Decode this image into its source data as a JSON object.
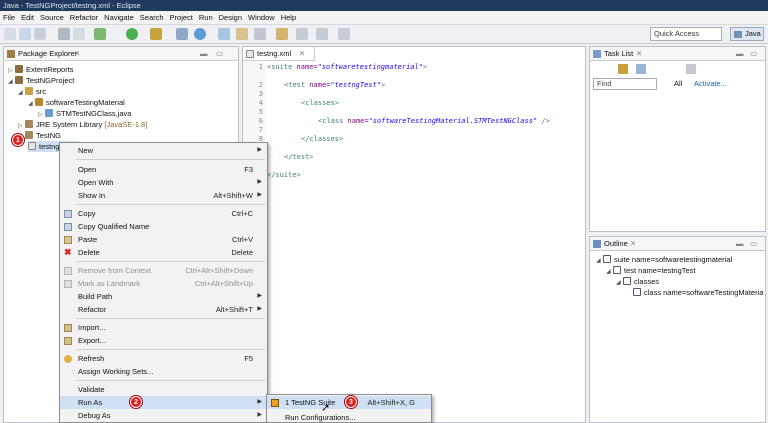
{
  "window": {
    "title": "Java - TestNGProject/testng.xml - Eclipse"
  },
  "menubar": [
    "File",
    "Edit",
    "Source",
    "Refactor",
    "Navigate",
    "Search",
    "Project",
    "Run",
    "Design",
    "Window",
    "Help"
  ],
  "toolbar": {
    "quick_access": "Quick Access",
    "perspective": "Java"
  },
  "package_explorer": {
    "tab": "Package Explorer",
    "items": [
      "ExtentReports",
      "TestNGProject",
      "src",
      "softwareTestingMaterial",
      "STMTestNGClass.java",
      "JRE System Library",
      "[JavaSE-1.8]",
      "TestNG",
      "testng.xml"
    ]
  },
  "editor": {
    "tab": "testng.xml",
    "line_numbers": [
      "1",
      "2",
      "3",
      "4",
      "5",
      "6",
      "7",
      "8",
      "9",
      "10",
      "11"
    ],
    "lines": [
      {
        "pre": "<suite ",
        "attr": "name=",
        "val": "\"softwaretestingmaterial\"",
        "post": ">"
      },
      {
        "pre": "<test ",
        "attr": "name=",
        "val": "\"testngTest\"",
        "post": ">"
      },
      {
        "pre": "<classes>",
        "attr": "",
        "val": "",
        "post": ""
      },
      {
        "pre": "<class ",
        "attr": "name=",
        "val": "\"softwareTestingMaterial.STMTestNGClass\"",
        "post": " />"
      },
      {
        "pre": "</classes>",
        "attr": "",
        "val": "",
        "post": ""
      },
      {
        "pre": "</test>",
        "attr": "",
        "val": "",
        "post": ""
      },
      {
        "pre": "</suite>",
        "attr": "",
        "val": "",
        "post": ""
      }
    ]
  },
  "task_list": {
    "tab": "Task List",
    "find_placeholder": "Find",
    "all_label": "All",
    "activate_label": "Activate..."
  },
  "outline": {
    "tab": "Outline",
    "items": [
      "suite name=softwaretestingmaterial",
      "test name=testngTest",
      "classes",
      "class name=softwareTestingMateria"
    ]
  },
  "context_menu": {
    "items": [
      {
        "label": "New",
        "key": "",
        "submenu": true,
        "disabled": false
      },
      {
        "label": "Open",
        "key": "F3",
        "submenu": false,
        "disabled": false
      },
      {
        "label": "Open With",
        "key": "",
        "submenu": true,
        "disabled": false
      },
      {
        "label": "Show In",
        "key": "Alt+Shift+W",
        "submenu": true,
        "disabled": false
      },
      {
        "label": "Copy",
        "key": "Ctrl+C",
        "submenu": false,
        "disabled": false
      },
      {
        "label": "Copy Qualified Name",
        "key": "",
        "submenu": false,
        "disabled": false
      },
      {
        "label": "Paste",
        "key": "Ctrl+V",
        "submenu": false,
        "disabled": false
      },
      {
        "label": "Delete",
        "key": "Delete",
        "submenu": false,
        "disabled": false
      },
      {
        "label": "Remove from Context",
        "key": "Ctrl+Alt+Shift+Down",
        "submenu": false,
        "disabled": true
      },
      {
        "label": "Mark as Landmark",
        "key": "Ctrl+Alt+Shift+Up",
        "submenu": false,
        "disabled": true
      },
      {
        "label": "Build Path",
        "key": "",
        "submenu": true,
        "disabled": false
      },
      {
        "label": "Refactor",
        "key": "Alt+Shift+T",
        "submenu": true,
        "disabled": false
      },
      {
        "label": "Import...",
        "key": "",
        "submenu": false,
        "disabled": false
      },
      {
        "label": "Export...",
        "key": "",
        "submenu": false,
        "disabled": false
      },
      {
        "label": "Refresh",
        "key": "F5",
        "submenu": false,
        "disabled": false
      },
      {
        "label": "Assign Working Sets...",
        "key": "",
        "submenu": false,
        "disabled": false
      },
      {
        "label": "Validate",
        "key": "",
        "submenu": false,
        "disabled": false
      },
      {
        "label": "Run As",
        "key": "",
        "submenu": true,
        "disabled": false
      },
      {
        "label": "Debug As",
        "key": "",
        "submenu": true,
        "disabled": false
      }
    ]
  },
  "run_as_submenu": {
    "items": [
      {
        "label": "1 TestNG Suite",
        "key": "Alt+Shift+X, G"
      },
      {
        "label": "Run Configurations..."
      }
    ]
  },
  "badges": [
    "1",
    "2",
    "3"
  ]
}
